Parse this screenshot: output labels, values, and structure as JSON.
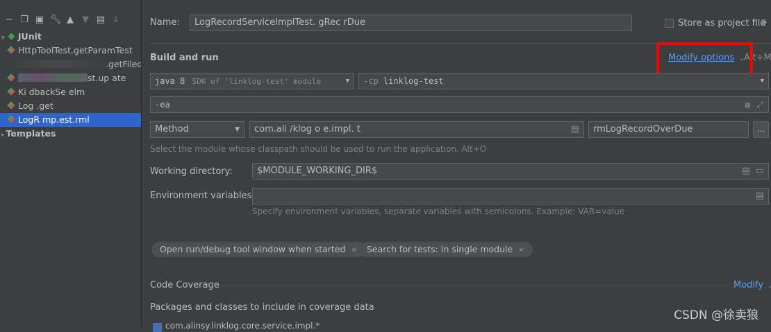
{
  "tree": {
    "junit_label": "JUnit",
    "items": [
      {
        "label": "HttpToolTest.getParamTest"
      },
      {
        "label": ".getFiled"
      },
      {
        "label": "st.up  ate"
      },
      {
        "label": "Ki        dbackSe    elm"
      },
      {
        "label": "Log                   .get"
      },
      {
        "label": "LogR             mp.est.rml"
      }
    ],
    "templates_label": "Templates"
  },
  "form": {
    "name_label": "Name:",
    "name_value": "LogRecordServiceImplTest.   gRec      rDue",
    "store_label": "Store as project file",
    "build_run_label": "Build and run",
    "modify_options_label": "Modify options",
    "modify_options_shortcut": "Alt+M",
    "jdk_value": "java 8",
    "jdk_hint": "SDK of 'linklog-test' module",
    "cp_flag": "-cp",
    "cp_value": "linklog-test",
    "vm_options": "-ea",
    "test_kind": "Method",
    "class_value": "com.ali    /klog   o          e.impl.          t",
    "method_value": "rmLogRecordOverDue",
    "browse_label": "...",
    "module_hint": "Select the module whose classpath should be used to run the application. Alt+O",
    "working_dir_label": "Working directory:",
    "working_dir_value": "$MODULE_WORKING_DIR$",
    "env_label": "Environment variables:",
    "env_value": "",
    "env_hint": "Specify environment variables, separate variables with semicolons. Example: VAR=value",
    "chip_1": "Open run/debug tool window when started",
    "chip_2": "Search for tests: In single module",
    "coverage_label": "Code Coverage",
    "coverage_modify": "Modify",
    "packages_label": "Packages and classes to include in coverage data",
    "package_item": "com.alinsy.linklog.core.service.impl.*"
  },
  "watermark": "CSDN @徐卖狼",
  "colors": {
    "background": "#3c3f41",
    "field": "#45494a",
    "link": "#589df6",
    "highlight": "#ff0000",
    "selection": "#0d293e"
  }
}
